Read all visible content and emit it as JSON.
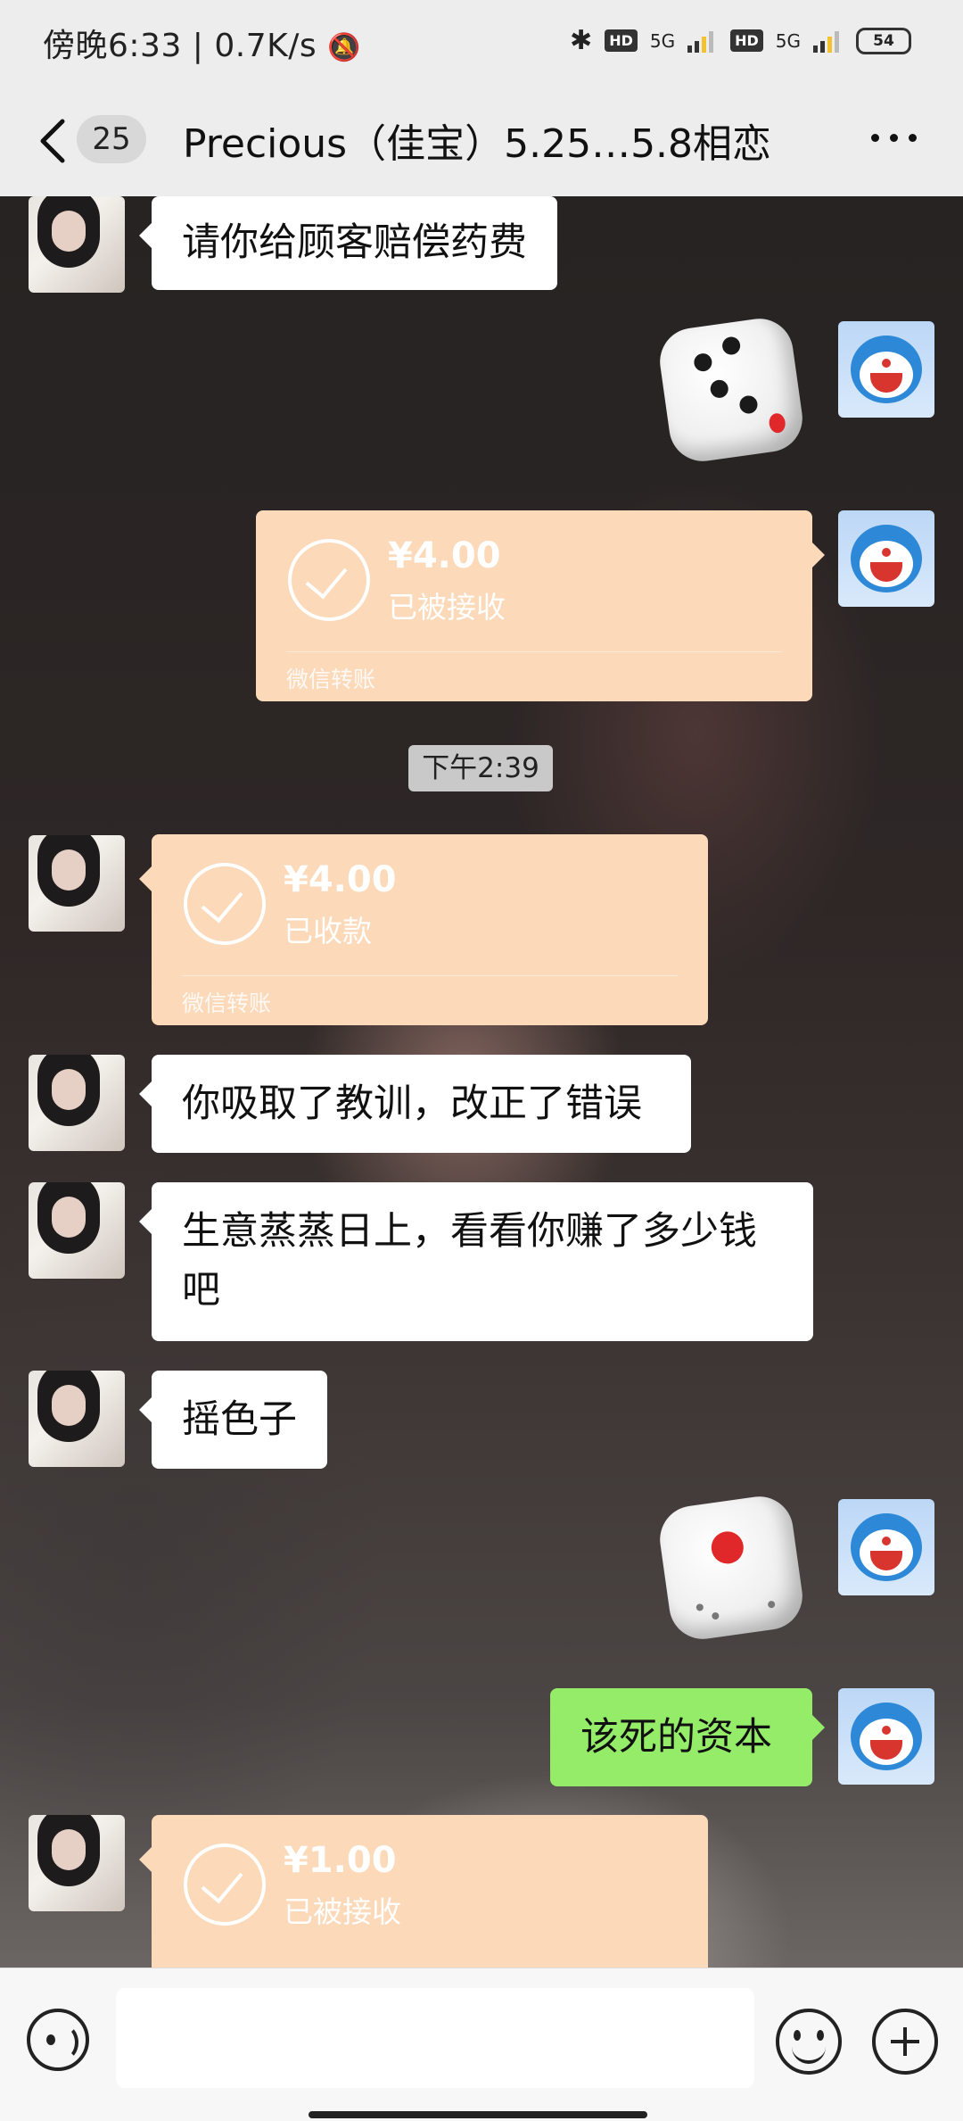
{
  "status_bar": {
    "time_speed": "傍晚6:33 | 0.7K/s",
    "network_1": "5G",
    "network_2": "5G",
    "hd_label": "HD",
    "battery": "54"
  },
  "header": {
    "unread_count": "25",
    "title": "Precious（佳宝）5.25…5.8相恋"
  },
  "messages": {
    "m1": "请你给顾客赔偿药费",
    "transfer1": {
      "amount": "¥4.00",
      "status": "已被接收",
      "source": "微信转账"
    },
    "timestamp": "下午2:39",
    "transfer2": {
      "amount": "¥4.00",
      "status": "已收款",
      "source": "微信转账"
    },
    "m2": "你吸取了教训，改正了错误",
    "m3_line1": "生意蒸蒸日上，看看你赚了多少钱",
    "m3_line2": "吧",
    "m4": "摇色子",
    "m5": "该死的资本",
    "transfer3": {
      "amount": "¥1.00",
      "status": "已被接收"
    }
  },
  "colors": {
    "transfer_bg": "#fbd9b9",
    "sent_bubble": "#95ec69",
    "received_bubble": "#ffffff"
  }
}
